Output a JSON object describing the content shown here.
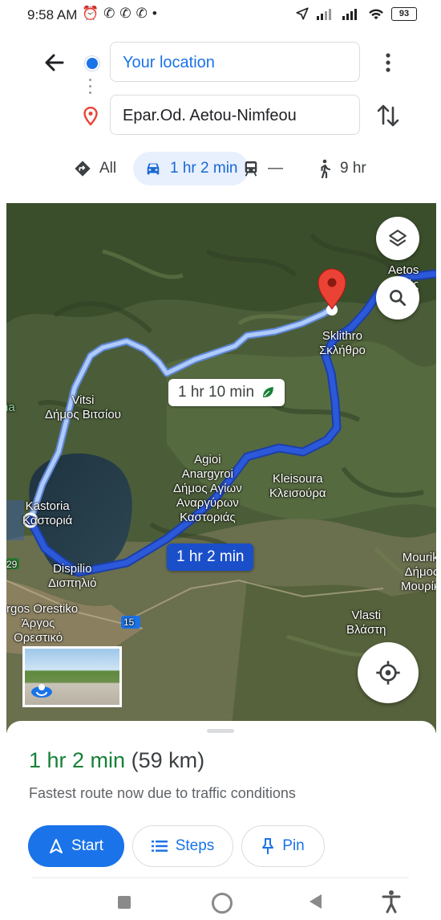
{
  "status_bar": {
    "time": "9:58 AM",
    "left_icons": [
      "alarm-icon",
      "viber-icon",
      "viber-icon",
      "viber-icon",
      "dot-icon"
    ],
    "battery": "93"
  },
  "directions": {
    "origin": "Your location",
    "destination": "Epar.Od. Aetou-Nimfeou"
  },
  "modes": {
    "all": "All",
    "driving": "1 hr 2 min",
    "transit": "—",
    "walking": "9 hr"
  },
  "map": {
    "labels": {
      "aetos": "Aetos\nΑετός",
      "sklithro": "Sklithro\nΣκλήθρο",
      "vitsi": "Vitsi\nΔήμος Βιτσίου",
      "agioi": "Agioi\nAnargyroi\nΔήμος Αγίων\nΑναργύρων\nΚαστοριάς",
      "kleisoura": "Kleisoura\nΚλεισούρα",
      "kastoria": "Kastoria\nΚαστοριά",
      "dispilio": "Dispilio\nΔισπηλιό",
      "argos": "Argos Orestiko\nΆργος\nΟρεστικό",
      "vlasti": "Vlasti\nΒλάστη",
      "mouriki": "Mouriki\nΔήμος\nΜουρίκι",
      "edge_na": "na",
      "road_29": "29",
      "road_15": "15"
    },
    "alt_route_time": "1 hr 10 min",
    "main_route_time": "1 hr 2 min",
    "route_color": "#2b59d9",
    "alt_route_color": "#aecbfa"
  },
  "sheet": {
    "eta_time": "1 hr 2 min",
    "eta_distance": "(59 km)",
    "description": "Fastest route now due to traffic conditions",
    "start_label": "Start",
    "steps_label": "Steps",
    "pin_label": "Pin"
  }
}
